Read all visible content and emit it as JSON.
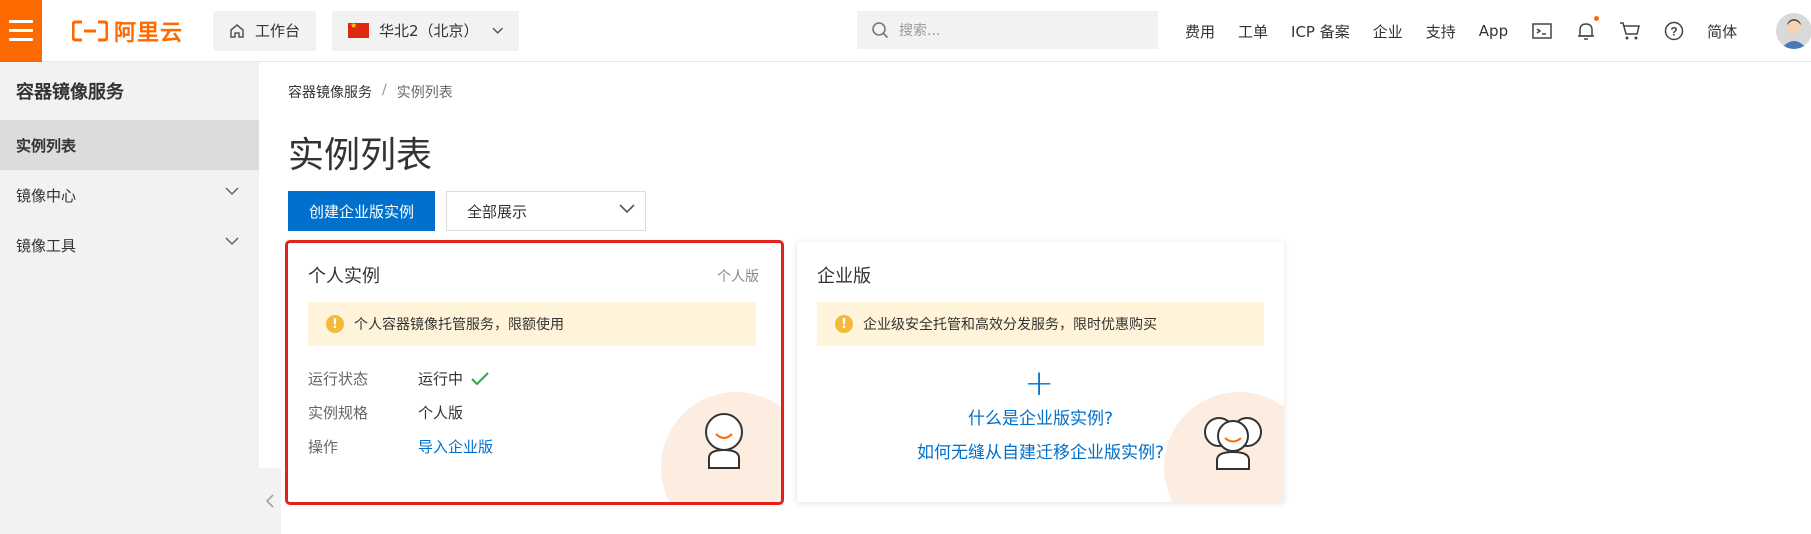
{
  "header": {
    "logo_text": "阿里云",
    "workbench_label": "工作台",
    "region_label": "华北2（北京）",
    "search_placeholder": "搜索...",
    "links": [
      "费用",
      "工单",
      "ICP 备案",
      "企业",
      "支持",
      "App"
    ],
    "language_label": "简体",
    "brand_color": "#ff6a00"
  },
  "sidebar": {
    "title": "容器镜像服务",
    "items": [
      {
        "label": "实例列表",
        "active": true
      },
      {
        "label": "镜像中心",
        "expandable": true
      },
      {
        "label": "镜像工具",
        "expandable": true
      }
    ]
  },
  "breadcrumb": [
    "容器镜像服务",
    "/",
    "实例列表"
  ],
  "page_title": "实例列表",
  "toolbar": {
    "create_button": "创建企业版实例",
    "filter_value": "全部展示"
  },
  "personal_card": {
    "title": "个人实例",
    "tag": "个人版",
    "notice": "个人容器镜像托管服务，限额使用",
    "rows": [
      {
        "label": "运行状态",
        "value": "运行中"
      },
      {
        "label": "实例规格",
        "value": "个人版"
      },
      {
        "label": "操作",
        "value": "导入企业版"
      }
    ],
    "highlight_color": "#e0211c"
  },
  "enterprise_card": {
    "title": "企业版",
    "notice": "企业级安全托管和高效分发服务，限时优惠购买",
    "link1": "什么是企业版实例?",
    "link2": "如何无缝从自建迁移企业版实例?"
  }
}
